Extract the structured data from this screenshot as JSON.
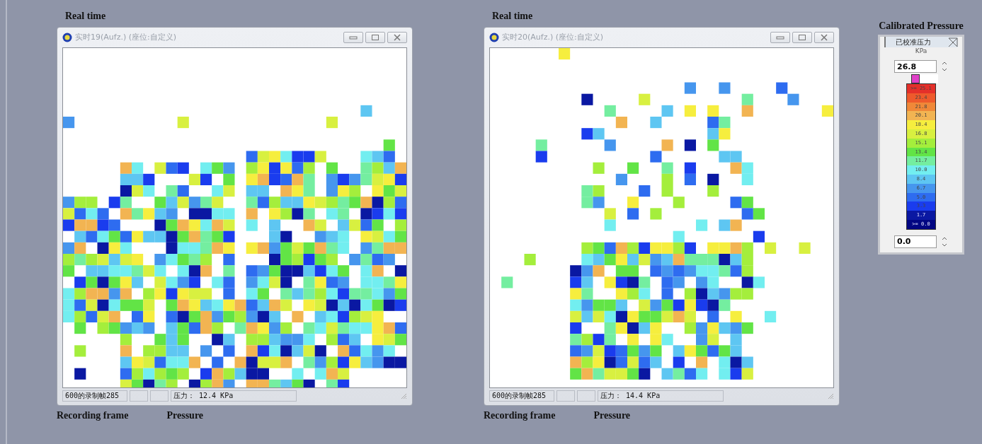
{
  "panels": [
    {
      "caption_top": "Real time",
      "window": {
        "title": "实时19(Aufz.) (座位:自定义)",
        "frame": "600的录制帧285",
        "pressure": "压力： 12.4 KPa"
      },
      "caption_frame": "Recording frame",
      "caption_pressure": "Pressure"
    },
    {
      "caption_top": "Real time",
      "window": {
        "title": "实时20(Aufz.) (座位:自定义)",
        "frame": "600的录制帧285",
        "pressure": "压力： 14.4 KPa"
      },
      "caption_frame": "Recording frame",
      "caption_pressure": "Pressure"
    }
  ],
  "legend": {
    "caption": "Calibrated Pressure",
    "title": "已校准压力",
    "unit": "KPa",
    "max": "26.8",
    "min": "0.0",
    "bands": [
      {
        "label": ">= 25.1",
        "color": "#e4302a"
      },
      {
        "label": "23.4",
        "color": "#ee5a2c"
      },
      {
        "label": "21.8",
        "color": "#f08838"
      },
      {
        "label": "20.1",
        "color": "#f2b452"
      },
      {
        "label": "18.4",
        "color": "#f6ee3e"
      },
      {
        "label": "16.8",
        "color": "#d8f040"
      },
      {
        "label": "15.1",
        "color": "#a4ee3c"
      },
      {
        "label": "13.4",
        "color": "#62e446"
      },
      {
        "label": "11.7",
        "color": "#74eea0"
      },
      {
        "label": "10.0",
        "color": "#72eef0"
      },
      {
        "label": "8.4",
        "color": "#5ec6f2"
      },
      {
        "label": "6.7",
        "color": "#4696ee"
      },
      {
        "label": "5.0",
        "color": "#2e6cf0"
      },
      {
        "label": "3.3",
        "color": "#1a3cee"
      },
      {
        "label": "1.7",
        "color": "#0a18a2"
      },
      {
        "label": ">= 0.0",
        "color": "#020682"
      }
    ]
  }
}
